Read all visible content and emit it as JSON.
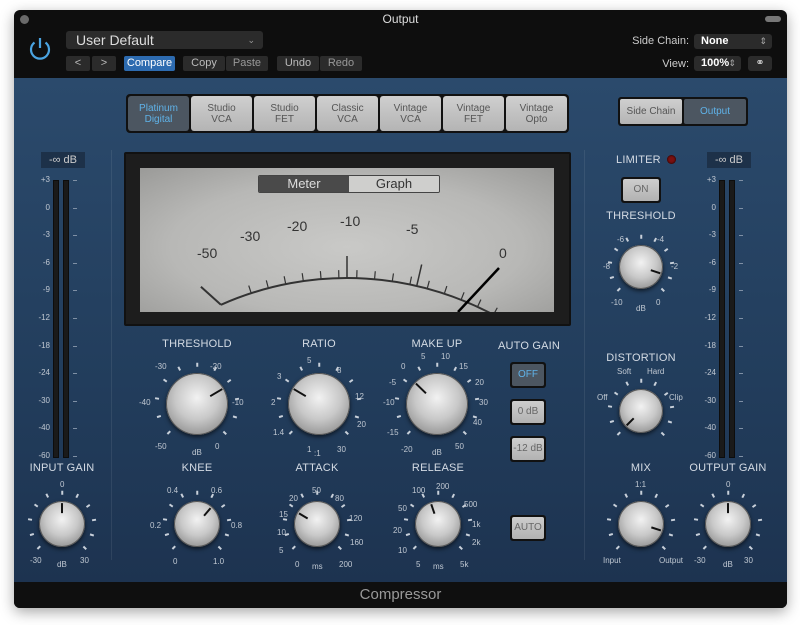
{
  "window": {
    "title": "Output",
    "footer": "Compressor"
  },
  "header": {
    "preset": "User Default",
    "nav_prev": "<",
    "nav_next": ">",
    "compare": "Compare",
    "copy": "Copy",
    "paste": "Paste",
    "undo": "Undo",
    "redo": "Redo",
    "side_chain_label": "Side Chain:",
    "side_chain_value": "None",
    "view_label": "View:",
    "view_value": "100%"
  },
  "modes": [
    {
      "label": "Platinum\nDigital",
      "active": true
    },
    {
      "label": "Studio\nVCA",
      "active": false
    },
    {
      "label": "Studio\nFET",
      "active": false
    },
    {
      "label": "Classic\nVCA",
      "active": false
    },
    {
      "label": "Vintage\nVCA",
      "active": false
    },
    {
      "label": "Vintage\nFET",
      "active": false
    },
    {
      "label": "Vintage\nOpto",
      "active": false
    }
  ],
  "sidechain_output_toggle": {
    "side_chain": "Side Chain",
    "output": "Output",
    "selected": "Output"
  },
  "input_meter": {
    "readout": "-∞ dB",
    "scale": [
      "+3",
      "0",
      "-3",
      "-6",
      "-9",
      "-12",
      "-18",
      "-24",
      "-30",
      "-40",
      "-60"
    ]
  },
  "output_meter": {
    "readout": "-∞ dB",
    "scale": [
      "+3",
      "0",
      "-3",
      "-6",
      "-9",
      "-12",
      "-18",
      "-24",
      "-30",
      "-40",
      "-60"
    ]
  },
  "vu": {
    "tab_meter": "Meter",
    "tab_graph": "Graph",
    "selected": "Meter",
    "scale": [
      "-50",
      "-30",
      "-20",
      "-10",
      "-5",
      "0"
    ],
    "needle_value_db": 0
  },
  "knobs": {
    "threshold": {
      "label": "THRESHOLD",
      "unit": "dB",
      "ticks": [
        "-50",
        "-40",
        "-30",
        "-20",
        "-10",
        "0"
      ],
      "value_fraction": 0.72
    },
    "ratio": {
      "label": "RATIO",
      "unit": ":1",
      "ticks": [
        "1",
        "1.4",
        "2",
        "3",
        "5",
        "8",
        "12",
        "20",
        "30"
      ],
      "value_fraction": 0.28
    },
    "make_up": {
      "label": "MAKE UP",
      "unit": "dB",
      "ticks": [
        "-20",
        "-15",
        "-10",
        "-5",
        "0",
        "5",
        "10",
        "15",
        "20",
        "30",
        "40",
        "50"
      ],
      "value_fraction": 0.33
    },
    "knee": {
      "label": "KNEE",
      "unit": "",
      "ticks": [
        "0",
        "0.2",
        "0.4",
        "0.6",
        "0.8",
        "1.0"
      ],
      "value_fraction": 0.65
    },
    "attack": {
      "label": "ATTACK",
      "unit": "ms",
      "ticks": [
        "0",
        "5",
        "10",
        "15",
        "20",
        "50",
        "80",
        "120",
        "160",
        "200"
      ],
      "value_fraction": 0.28
    },
    "release": {
      "label": "RELEASE",
      "unit": "ms",
      "ticks": [
        "5",
        "10",
        "20",
        "50",
        "100",
        "200",
        "500",
        "1k",
        "2k",
        "5k"
      ],
      "value_fraction": 0.43
    },
    "input_gain": {
      "label": "INPUT GAIN",
      "unit": "dB",
      "ticks": [
        "-30",
        "0",
        "30"
      ],
      "value_fraction": 0.5
    },
    "limiter_threshold": {
      "label": "THRESHOLD",
      "unit": "dB",
      "ticks": [
        "-10",
        "-8",
        "-6",
        "-4",
        "-2",
        "0"
      ],
      "value_fraction": 0.9
    },
    "distortion": {
      "label": "DISTORTION",
      "ticks": [
        "Off",
        "Soft",
        "Hard",
        "Clip"
      ],
      "value_fraction": 0.0
    },
    "mix": {
      "label": "MIX",
      "ticks": [
        "Input",
        "1:1",
        "Output"
      ],
      "value_fraction": 0.9
    },
    "output_gain": {
      "label": "OUTPUT GAIN",
      "unit": "dB",
      "ticks": [
        "-30",
        "0",
        "30"
      ],
      "value_fraction": 0.5
    }
  },
  "auto_gain": {
    "label": "AUTO GAIN",
    "off": "OFF",
    "zero_db": "0 dB",
    "minus12": "-12 dB",
    "selected": "OFF"
  },
  "auto_button": "AUTO",
  "limiter": {
    "label": "LIMITER",
    "on_button": "ON",
    "active": false
  },
  "colors": {
    "panel": "#2b4a6c",
    "accent": "#5fb2e8",
    "compare": "#2d6bb0",
    "led": "#7a1010"
  }
}
